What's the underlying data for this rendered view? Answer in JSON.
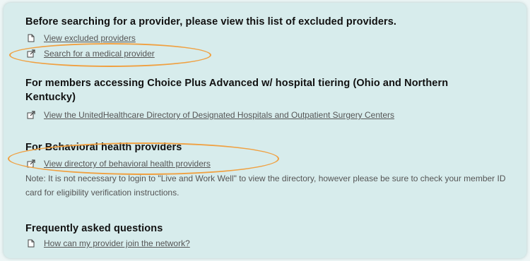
{
  "sections": [
    {
      "heading": "Before searching for a provider, please view this list of excluded providers.",
      "links": [
        {
          "label": "View excluded providers",
          "icon": "document-icon"
        },
        {
          "label": "Search for a medical provider",
          "icon": "external-link-icon"
        }
      ]
    },
    {
      "heading": "For members accessing Choice Plus Advanced w/ hospital tiering (Ohio and Northern Kentucky)",
      "links": [
        {
          "label": "View the UnitedHealthcare Directory of Designated Hospitals and Outpatient Surgery Centers",
          "icon": "external-link-icon"
        }
      ]
    },
    {
      "heading": "For Behavioral health providers",
      "links": [
        {
          "label": "View directory of behavioral health providers",
          "icon": "external-link-icon"
        }
      ],
      "note": "Note: It is not necessary to login to \"Live and Work Well\" to view the directory, however please be sure to check your member ID card for eligibility verification instructions."
    },
    {
      "heading": "Frequently asked questions",
      "links": [
        {
          "label": "How can my provider join the network?",
          "icon": "document-icon"
        }
      ]
    }
  ],
  "colors": {
    "panel": "#d7ecec",
    "highlight": "#f0a040",
    "link": "#555555"
  }
}
